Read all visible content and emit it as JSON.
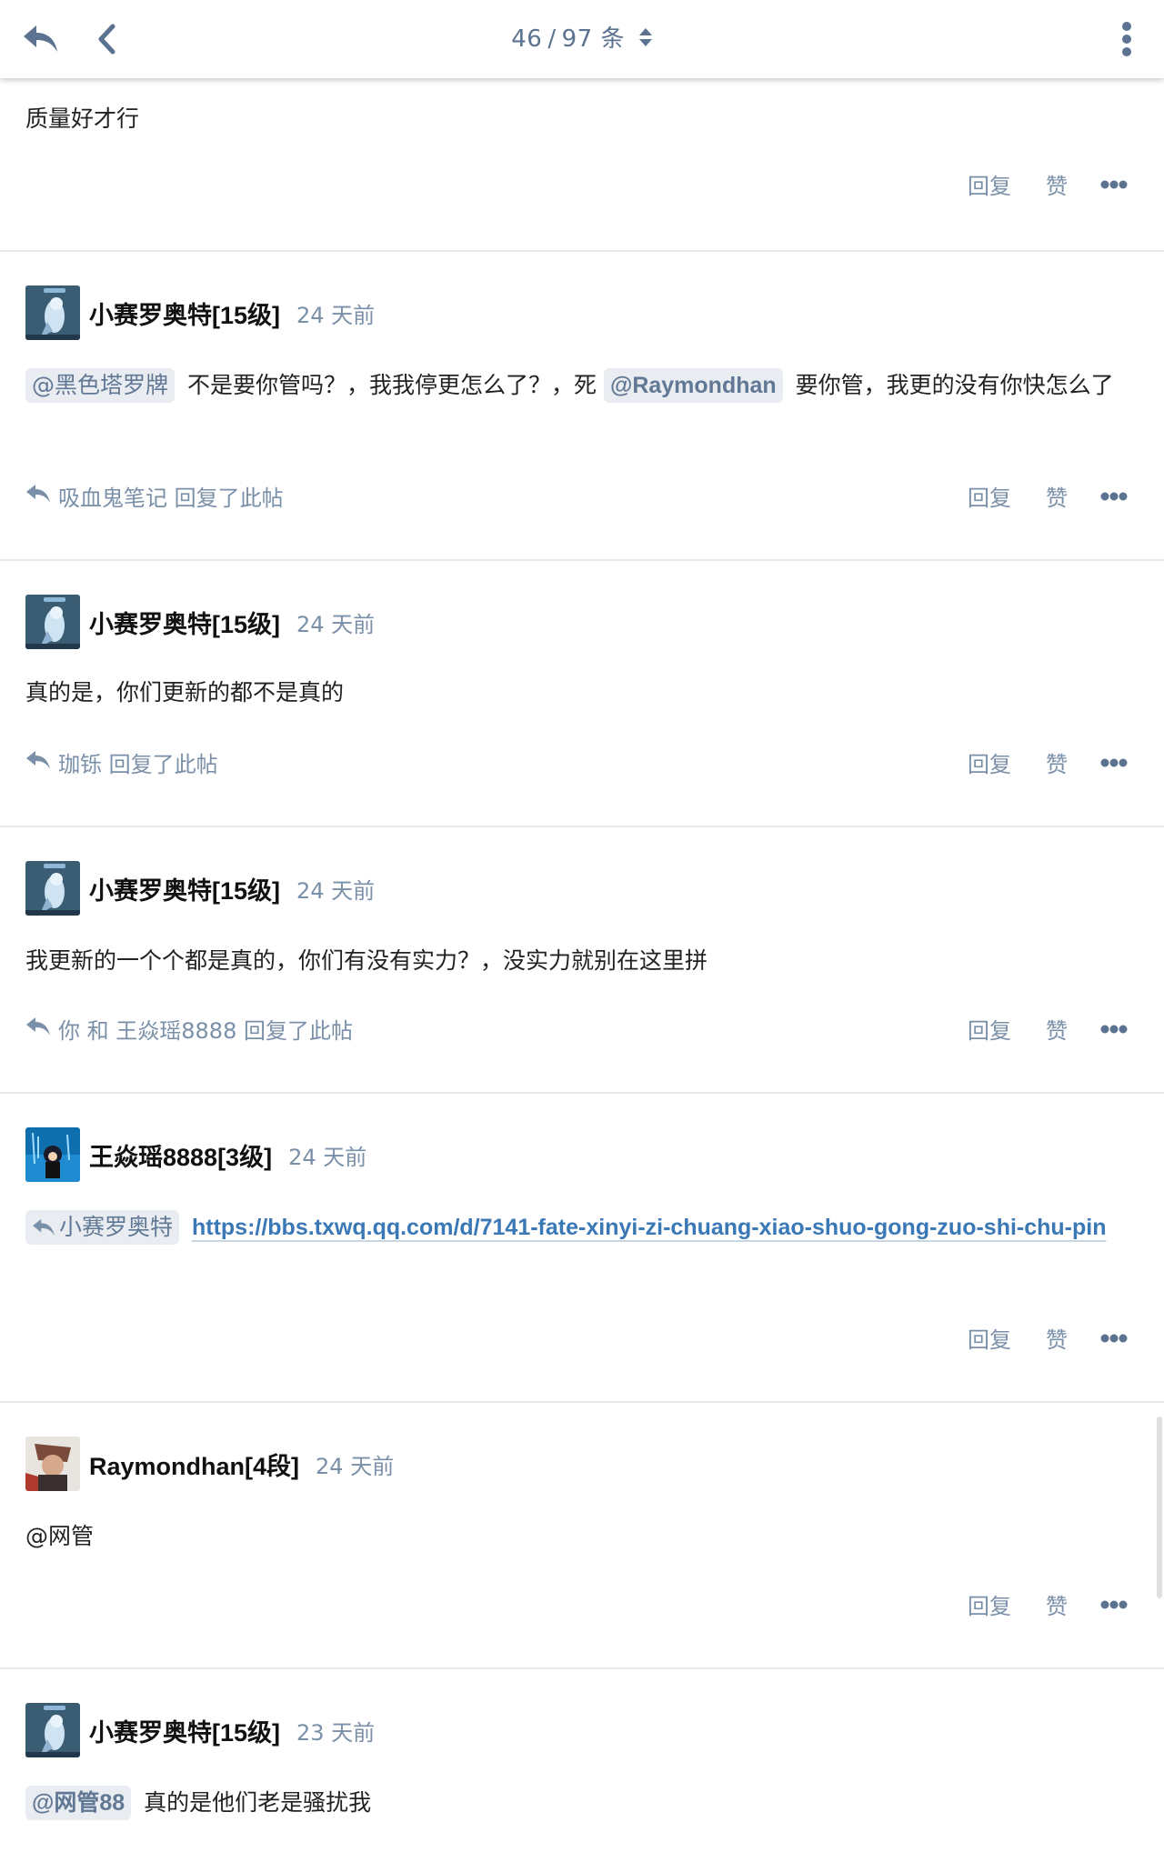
{
  "header": {
    "position": "46",
    "separator": "/",
    "total": "97",
    "unit": "条"
  },
  "actions": {
    "reply": "回复",
    "like": "赞"
  },
  "posts": [
    {
      "content": "质量好才行"
    },
    {
      "username": "小赛罗奥特[15级]",
      "time": "24 天前",
      "mention1": "@黑色塔罗牌",
      "text1": "不是要你管吗？，我我停更怎么了？，死",
      "mention2": "@Raymondhan",
      "text2": "要你管，我更的没有你快怎么了",
      "replied": "吸血鬼笔记 回复了此帖"
    },
    {
      "username": "小赛罗奥特[15级]",
      "time": "24 天前",
      "content": "真的是，你们更新的都不是真的",
      "replied": "珈铄 回复了此帖"
    },
    {
      "username": "小赛罗奥特[15级]",
      "time": "24 天前",
      "content": "我更新的一个个都是真的，你们有没有实力？，没实力就别在这里拼",
      "replied": "你 和 王焱瑶8888 回复了此帖"
    },
    {
      "username": "王焱瑶8888[3级]",
      "time": "24 天前",
      "reply_to": "小赛罗奥特",
      "link": "https://bbs.txwq.qq.com/d/7141-fate-xinyi-zi-chuang-xiao-shuo-gong-zuo-shi-chu-pin"
    },
    {
      "username": "Raymondhan[4段]",
      "time": "24 天前",
      "content": "@网管"
    },
    {
      "username": "小赛罗奥特[15级]",
      "time": "23 天前",
      "mention1": "@网管88",
      "text1": "真的是他们老是骚扰我"
    }
  ],
  "icons": {
    "back": "reply-back-icon",
    "chevron": "chevron-left-icon",
    "menu": "more-vertical-icon",
    "sort": "sort-updown-icon",
    "more": "more-horizontal-icon"
  },
  "colors": {
    "muted": "#7a8fa8",
    "header_icon": "#5b7290",
    "link": "#3a78b6",
    "mention_bg": "#e9edf2"
  }
}
